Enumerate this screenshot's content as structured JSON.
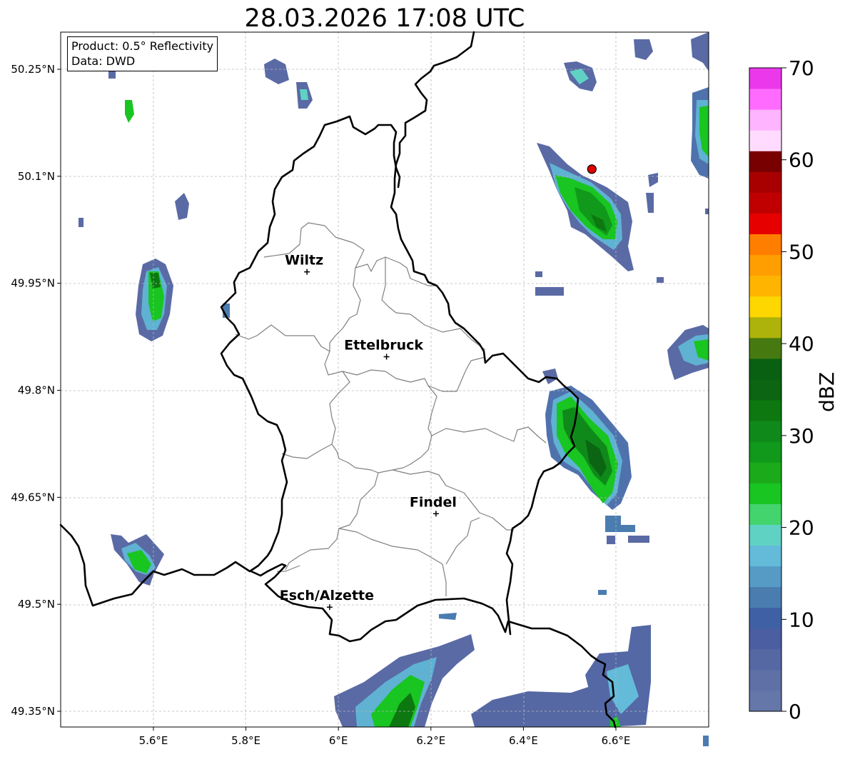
{
  "title": "28.03.2026 17:08 UTC",
  "info_box": {
    "product": "Product: 0.5° Reflectivity",
    "source": "Data: DWD"
  },
  "lat_labels": [
    "50.25°N",
    "50.1°N",
    "49.95°N",
    "49.8°N",
    "49.65°N",
    "49.5°N",
    "49.35°N"
  ],
  "lon_labels": [
    "5.6°E",
    "5.8°E",
    "6°E",
    "6.2°E",
    "6.4°E",
    "6.6°E"
  ],
  "lat_ticks": [
    50.25,
    50.1,
    49.95,
    49.8,
    49.65,
    49.5,
    49.35
  ],
  "lon_ticks": [
    5.6,
    5.8,
    6.0,
    6.2,
    6.4,
    6.6
  ],
  "extent": {
    "lon_min": 5.4,
    "lon_max": 6.8,
    "lat_min": 49.3,
    "lat_max": 50.3
  },
  "cities": [
    {
      "name": "Wiltz",
      "lon": 5.932,
      "lat": 49.966
    },
    {
      "name": "Ettelbruck",
      "lon": 6.104,
      "lat": 49.847
    },
    {
      "name": "Findel",
      "lon": 6.211,
      "lat": 49.627
    },
    {
      "name": "Esch/Alzette",
      "lon": 5.981,
      "lat": 49.496
    }
  ],
  "radar_site": {
    "lon": 6.548,
    "lat": 50.11,
    "color": "#dd0000"
  },
  "colorbar": {
    "label": "dBZ",
    "tick_labels": [
      "0",
      "10",
      "20",
      "30",
      "40",
      "50",
      "60",
      "70"
    ],
    "colors": [
      "#6577a9",
      "#5e70a6",
      "#5668a3",
      "#4b5ea2",
      "#4060a5",
      "#4a7cb0",
      "#559bc6",
      "#63bbd9",
      "#60d2c4",
      "#44d46e",
      "#19c521",
      "#1aaa1a",
      "#10991a",
      "#0f8a1a",
      "#0c780f",
      "#0b6512",
      "#096012",
      "#467a10",
      "#adb30a",
      "#ffd700",
      "#ffb500",
      "#ff9e00",
      "#ff7e00",
      "#e70000",
      "#c00000",
      "#a80000",
      "#790000",
      "#ffdcff",
      "#ffb4ff",
      "#ff6bff",
      "#eb38eb"
    ],
    "steps_db": [
      0,
      2.5,
      5,
      7.5,
      10,
      12.5,
      15,
      17.5,
      20,
      22.5,
      25,
      27.5,
      30,
      32.5,
      35,
      37.5,
      40,
      42.5,
      45,
      47.5,
      50,
      52.5,
      55,
      57.5,
      60,
      62.5,
      65,
      67.5,
      70
    ]
  },
  "radar_cells": [
    {
      "lon": 6.3,
      "lat": 49.64,
      "dbz": 28
    },
    {
      "lon": 6.61,
      "lat": 50.06,
      "dbz": 26
    },
    {
      "lon": 6.18,
      "lat": 49.34,
      "dbz": 24
    },
    {
      "lon": 5.61,
      "lat": 49.93,
      "dbz": 20
    },
    {
      "lon": 6.76,
      "lat": 50.17,
      "dbz": 21
    },
    {
      "lon": 6.75,
      "lat": 49.84,
      "dbz": 20
    },
    {
      "lon": 5.57,
      "lat": 49.58,
      "dbz": 19
    },
    {
      "lon": 6.7,
      "lat": 49.38,
      "dbz": 12
    }
  ],
  "colors": {
    "border": "#000000",
    "canton_border": "#808080",
    "grid": "#b8b8b8"
  }
}
